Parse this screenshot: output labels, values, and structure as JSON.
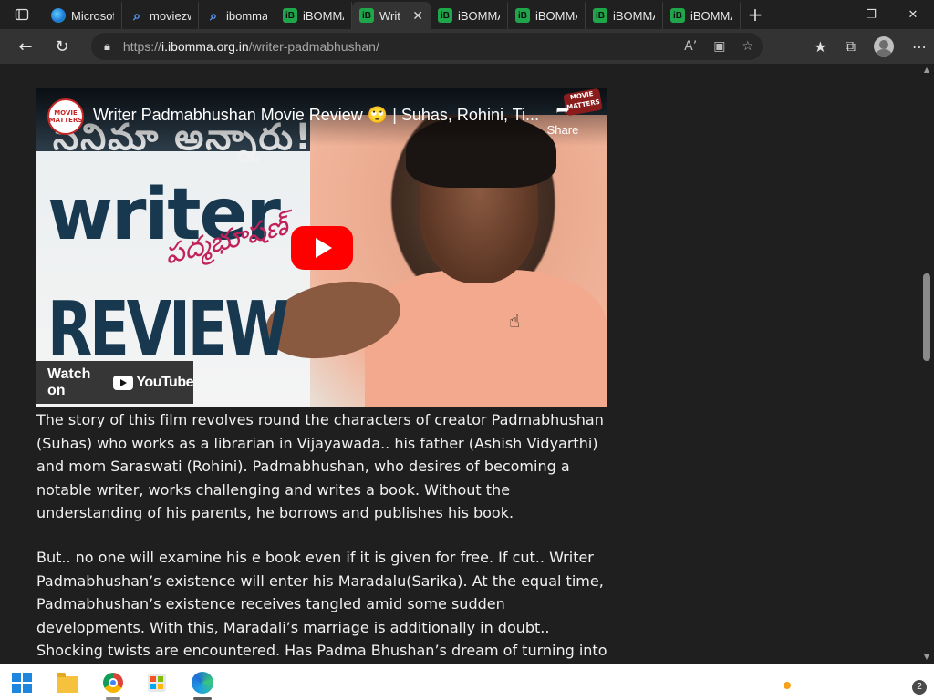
{
  "browser": {
    "tabs": [
      {
        "title": "Microsof",
        "icon": "edge-icon"
      },
      {
        "title": "moviezw",
        "icon": "search-icon"
      },
      {
        "title": "ibomma",
        "icon": "search-icon"
      },
      {
        "title": "iBOMMA",
        "icon": "ibomma-icon"
      },
      {
        "title": "Writ",
        "icon": "ibomma-icon",
        "active": true
      },
      {
        "title": "iBOMMA",
        "icon": "ibomma-icon"
      },
      {
        "title": "iBOMMA",
        "icon": "ibomma-icon"
      },
      {
        "title": "iBOMMA",
        "icon": "ibomma-icon"
      },
      {
        "title": "iBOMMA",
        "icon": "ibomma-icon"
      }
    ],
    "url_prefix": "https://",
    "url_host": "i.ibomma.org.in",
    "url_path": "/writer-padmabhushan/"
  },
  "video": {
    "channel_badge": "MOVIE MATTERS",
    "title": "Writer Padmabhushan Movie Review 🙄 | Suhas, Rohini, Ti...",
    "share_label": "Share",
    "watch_on": "Watch on",
    "youtube": "YouTube",
    "thumb_top_text": "సినిమా అన్నారు!",
    "thumb_word_writer": "writer",
    "thumb_signature": "పద్మభూషణ్",
    "thumb_word_review": "REVIEW"
  },
  "article": {
    "paragraph_1": "The story of this film revolves round the characters of creator Padmabhushan (Suhas) who works as a librarian in Vijayawada.. his father (Ashish Vidyarthi) and mom Saraswati (Rohini). Padmabhushan, who desires of becoming a notable writer, works challenging and writes a book. Without the understanding of his parents, he borrows and publishes his book.",
    "paragraph_2": "But.. no one will examine his e book even if it is given for free. If cut.. Writer Padmabhushan’s existence will enter his Maradalu(Sarika). At the equal time, Padmabhushan’s existence receives tangled amid some sudden developments. With this, Maradali’s marriage is additionally in doubt.. Shocking twists are encountered. Has Padma Bhushan’s dream of turning into a author come actual or"
  },
  "taskbar": {
    "notification_count": "2"
  },
  "colors": {
    "page_bg": "#1f1f1f",
    "text": "#f1f1f1",
    "yt_red": "#ff0000",
    "ibomma_green": "#1fa64a"
  }
}
